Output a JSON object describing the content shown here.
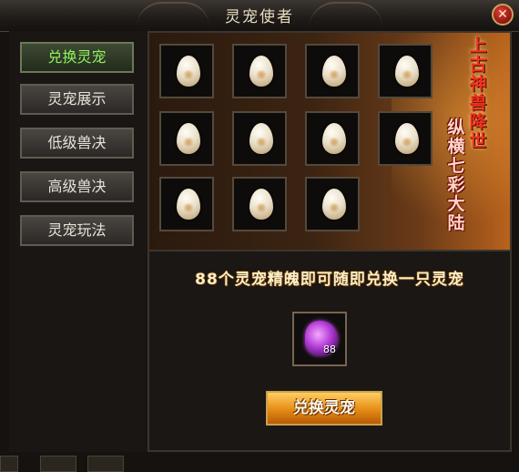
{
  "window": {
    "title": "灵宠使者",
    "close_icon": "close-icon"
  },
  "sidebar": {
    "items": [
      {
        "label": "兑换灵宠",
        "active": true
      },
      {
        "label": "灵宠展示",
        "active": false
      },
      {
        "label": "低级兽决",
        "active": false
      },
      {
        "label": "高级兽决",
        "active": false
      },
      {
        "label": "灵宠玩法",
        "active": false
      }
    ]
  },
  "banner": {
    "slogan_line1": "上古神兽降世",
    "slogan_line2": "纵横七彩大陆",
    "egg_count": 11,
    "egg_icon": "egg-icon"
  },
  "exchange": {
    "info_text": "88个灵宠精魄即可随即兑换一只灵宠",
    "item_count": "88",
    "item_icon": "pet-essence-icon",
    "button_label": "兑换灵宠"
  },
  "colors": {
    "active_text": "#8ff35c",
    "slogan_red": "#f0321c",
    "button_gold": "#e58c14"
  }
}
